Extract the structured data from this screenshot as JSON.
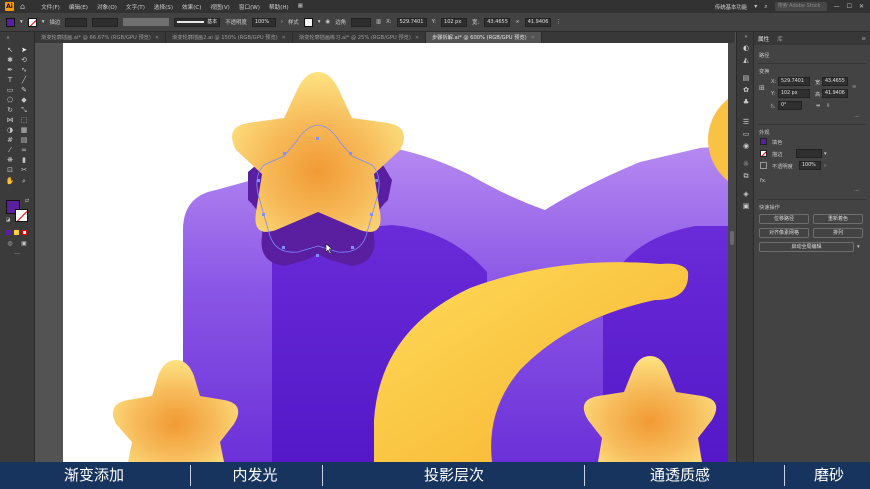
{
  "menubar": {
    "logo": "Ai",
    "menus": [
      "文件(F)",
      "编辑(E)",
      "对象(O)",
      "文字(T)",
      "选择(S)",
      "效果(C)",
      "视图(V)",
      "窗口(W)",
      "帮助(H)"
    ],
    "workspace": "传统基本功能",
    "search_placeholder": "搜索 Adobe Stock"
  },
  "controlbar": {
    "stroke_label": "描边",
    "stroke_line_label": "基本",
    "opacity_label": "不透明度",
    "opacity_value": "100%",
    "style_label": "样式",
    "corner_label": "边角",
    "x_value": "529.7401",
    "y_value": "102 px",
    "w_value": "43.4655",
    "h_value": "41.9406",
    "fill_color": "#5a1ea0",
    "stroke_color": "#ffffff"
  },
  "tabs": [
    {
      "label": "渐变轮廓插画.ai* @ 66.67% (RGB/GPU 预览)",
      "active": false
    },
    {
      "label": "渐变轮廓插画2.ai @ 150% (RGB/GPU 预览)",
      "active": false
    },
    {
      "label": "渐变轮廓插画练习.ai* @ 25% (RGB/GPU 预览)",
      "active": false
    },
    {
      "label": "步骤拆解.ai* @ 600% (RGB/GPU 预览)",
      "active": true
    }
  ],
  "panel": {
    "tabs": [
      "属性",
      "库"
    ],
    "section_path": "路径",
    "section_transform": "变换",
    "x_label": "X:",
    "x_value": "529.7401",
    "y_label": "Y:",
    "y_value": "102 px",
    "w_label": "宽:",
    "w_value": "43.4655",
    "h_label": "高:",
    "h_value": "41.9406",
    "angle_value": "0°",
    "section_appearance": "外观",
    "fill_label": "填色",
    "stroke_label": "描边",
    "opacity_label": "不透明度",
    "opacity_value": "100%",
    "fx_label": "fx.",
    "section_quick": "快速操作",
    "quick_buttons": [
      "位移路径",
      "重新着色",
      "对齐像素网格",
      "排列",
      "启动全局编辑"
    ]
  },
  "subtitles": [
    "渐变添加",
    "内发光",
    "投影层次",
    "通透质感",
    "磨砂"
  ],
  "colors": {
    "accent_purple": "#6a2bd8",
    "star_gold": "#f7b84a",
    "subtitle_bg": "#17345e"
  }
}
